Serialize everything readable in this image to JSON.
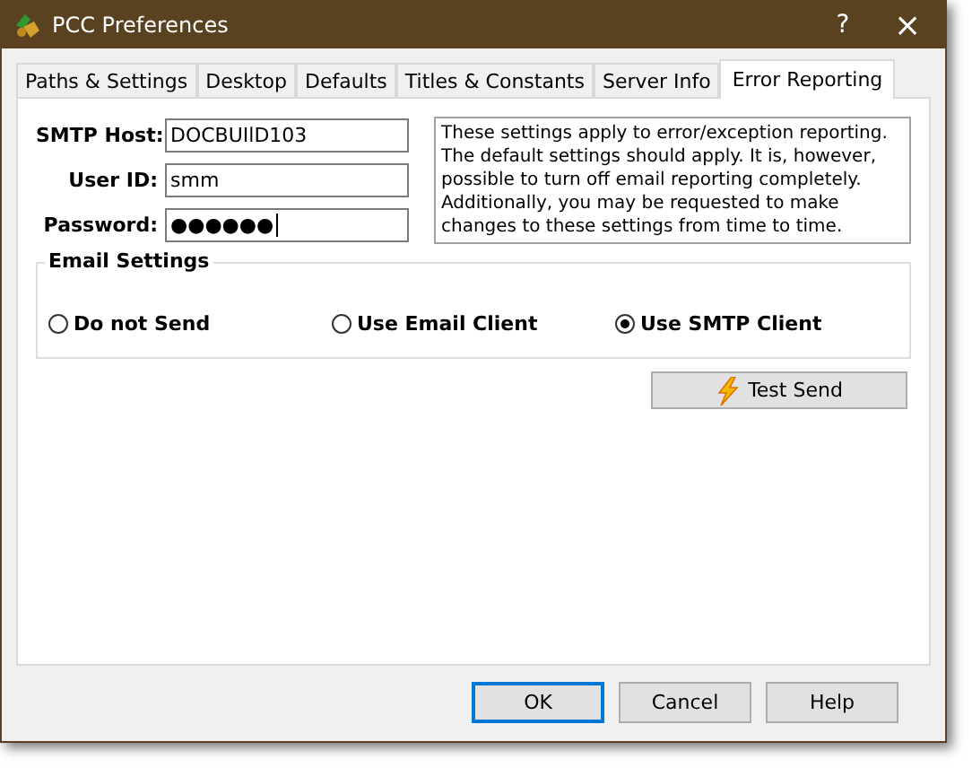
{
  "window": {
    "title": "PCC Preferences",
    "help": "?",
    "close": "×"
  },
  "tabs": [
    {
      "label": "Paths & Settings",
      "selected": false
    },
    {
      "label": "Desktop",
      "selected": false
    },
    {
      "label": "Defaults",
      "selected": false
    },
    {
      "label": "Titles & Constants",
      "selected": false
    },
    {
      "label": "Server Info",
      "selected": false
    },
    {
      "label": "Error Reporting",
      "selected": true
    }
  ],
  "fields": [
    {
      "label": "SMTP Host:",
      "value": "DOCBUIlD103",
      "focused": false
    },
    {
      "label": "User ID:",
      "value": "smm",
      "focused": false
    },
    {
      "label": "Password:",
      "value": "●●●●●●",
      "focused": true
    }
  ],
  "info_text": "These settings apply to error/exception reporting. The default settings should apply. It is, however, possible to turn off email reporting completely. Additionally, you may be requested to make changes to these settings from time to time.",
  "email_settings": {
    "title": "Email Settings",
    "options": [
      {
        "label": "Do not Send",
        "selected": false
      },
      {
        "label": "Use Email Client",
        "selected": false
      },
      {
        "label": "Use SMTP Client",
        "selected": true
      }
    ]
  },
  "test_button": "Test Send",
  "buttons": [
    {
      "label": "OK",
      "default": true
    },
    {
      "label": "Cancel",
      "default": false
    },
    {
      "label": "Help",
      "default": false
    }
  ]
}
